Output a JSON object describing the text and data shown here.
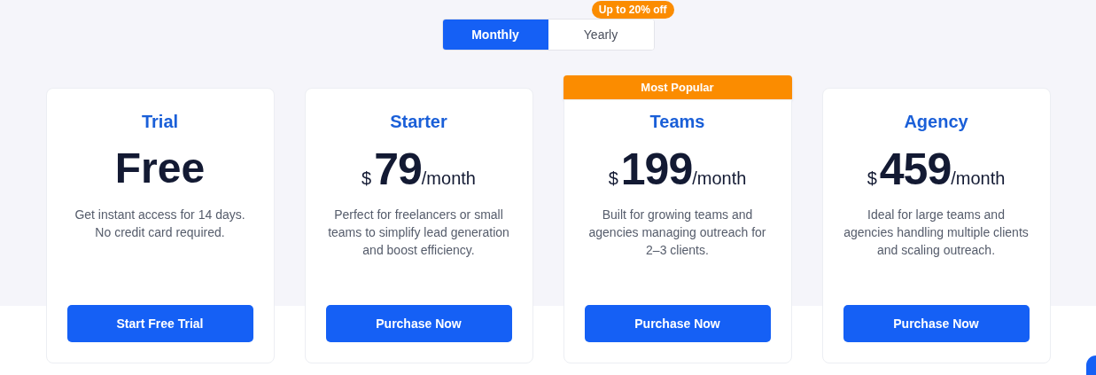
{
  "billing_toggle": {
    "options": [
      {
        "label": "Monthly",
        "selected": true
      },
      {
        "label": "Yearly",
        "selected": false
      }
    ],
    "badge": "Up to 20% off"
  },
  "plans": [
    {
      "name": "Trial",
      "price": {
        "kind": "text",
        "text": "Free"
      },
      "description": "Get instant access for 14 days. No credit card required.",
      "button": "Start Free Trial"
    },
    {
      "name": "Starter",
      "price": {
        "kind": "amount",
        "currency": "$",
        "amount": "79",
        "period": "/month"
      },
      "description": "Perfect for freelancers or small teams to simplify lead generation and boost efficiency.",
      "button": "Purchase Now"
    },
    {
      "name": "Teams",
      "badge": "Most Popular",
      "price": {
        "kind": "amount",
        "currency": "$",
        "amount": "199",
        "period": "/month"
      },
      "description": "Built for growing teams and agencies managing outreach for 2–3 clients.",
      "button": "Purchase Now"
    },
    {
      "name": "Agency",
      "price": {
        "kind": "amount",
        "currency": "$",
        "amount": "459",
        "period": "/month"
      },
      "description": "Ideal for large teams and agencies handling multiple clients and scaling outreach.",
      "button": "Purchase Now"
    }
  ]
}
